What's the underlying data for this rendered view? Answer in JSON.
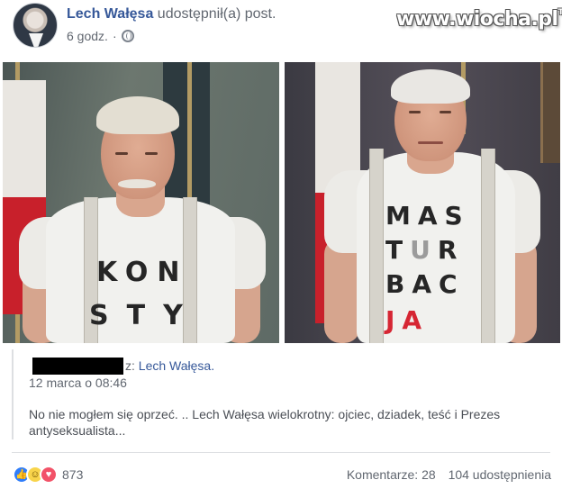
{
  "post": {
    "author_name": "Lech Wałęsa",
    "action": "udostępnił(a) post.",
    "time": "6 godz.",
    "privacy_icon": "globe-icon"
  },
  "watermark": {
    "text": "www.wiocha.pl",
    "tm": "TM"
  },
  "photos": {
    "left": {
      "shirt_lines": [
        "KON",
        "STY"
      ]
    },
    "right": {
      "shirt_lines": [
        "MAS",
        "TUR",
        "BAC",
        "JA"
      ]
    }
  },
  "quoted_post": {
    "from_prefix": "z:",
    "from_name": "Lech Wałęsa.",
    "date": "12 marca o 08:46",
    "body": "No nie mogłem się oprzeć. .. Lech Wałęsa wielokrotny: ojciec, dziadek, teść i Prezes antyseksualista..."
  },
  "footer": {
    "reactions": [
      "like-icon",
      "haha-icon",
      "love-icon"
    ],
    "reaction_count": "873",
    "comments": "Komentarze: 28",
    "shares": "104 udostępnienia"
  },
  "colors": {
    "link": "#365899",
    "muted": "#616770",
    "shirt_red_text": "#d62633"
  }
}
